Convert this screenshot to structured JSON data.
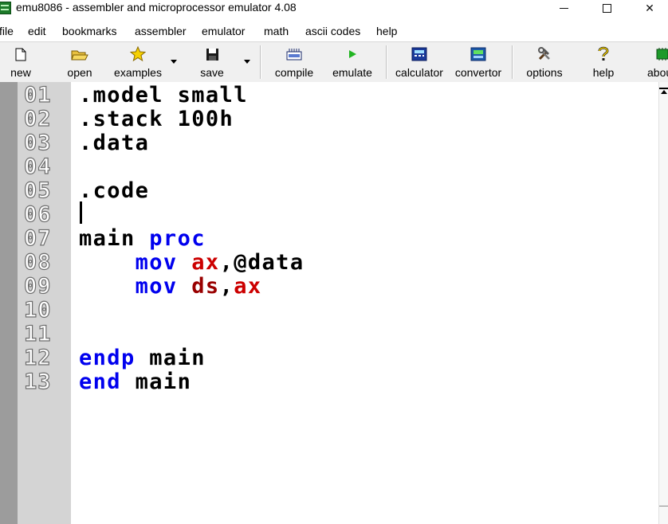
{
  "window": {
    "title": "emu8086 - assembler and microprocessor emulator 4.08",
    "close_glyph": "✕"
  },
  "menu": [
    "file",
    "edit",
    "bookmarks",
    "assembler",
    "emulator",
    "math",
    "ascii codes",
    "help"
  ],
  "toolbar": {
    "new": "new",
    "open": "open",
    "examples": "examples",
    "save": "save",
    "compile": "compile",
    "emulate": "emulate",
    "calculator": "calculator",
    "convertor": "convertor",
    "options": "options",
    "help": "help",
    "about": "about"
  },
  "editor": {
    "line_numbers": [
      "01",
      "02",
      "03",
      "04",
      "05",
      "06",
      "07",
      "08",
      "09",
      "10",
      "11",
      "12",
      "13"
    ],
    "lines": [
      {
        "segments": [
          {
            "text": ".model small",
            "style": "plain"
          }
        ]
      },
      {
        "segments": [
          {
            "text": ".stack 100h",
            "style": "plain"
          }
        ]
      },
      {
        "segments": [
          {
            "text": ".data",
            "style": "plain"
          }
        ]
      },
      {
        "segments": []
      },
      {
        "segments": [
          {
            "text": ".code",
            "style": "plain"
          }
        ]
      },
      {
        "segments": []
      },
      {
        "segments": [
          {
            "text": "main ",
            "style": "plain"
          },
          {
            "text": "proc",
            "style": "kw"
          }
        ]
      },
      {
        "segments": [
          {
            "text": "    ",
            "style": "plain"
          },
          {
            "text": "mov",
            "style": "kw"
          },
          {
            "text": " ",
            "style": "plain"
          },
          {
            "text": "ax",
            "style": "reg"
          },
          {
            "text": ",@data",
            "style": "plain"
          }
        ]
      },
      {
        "segments": [
          {
            "text": "    ",
            "style": "plain"
          },
          {
            "text": "mov",
            "style": "kw"
          },
          {
            "text": " ",
            "style": "plain"
          },
          {
            "text": "ds",
            "style": "reg-dark"
          },
          {
            "text": ",",
            "style": "plain"
          },
          {
            "text": "ax",
            "style": "reg"
          }
        ]
      },
      {
        "segments": []
      },
      {
        "segments": []
      },
      {
        "segments": [
          {
            "text": "endp",
            "style": "kw"
          },
          {
            "text": " main",
            "style": "plain"
          }
        ]
      },
      {
        "segments": [
          {
            "text": "end",
            "style": "kw"
          },
          {
            "text": " main",
            "style": "plain"
          }
        ]
      }
    ]
  },
  "colors": {
    "keyword": "#0000ee",
    "register": "#cc0000",
    "gutter": "#d4d4d4"
  }
}
